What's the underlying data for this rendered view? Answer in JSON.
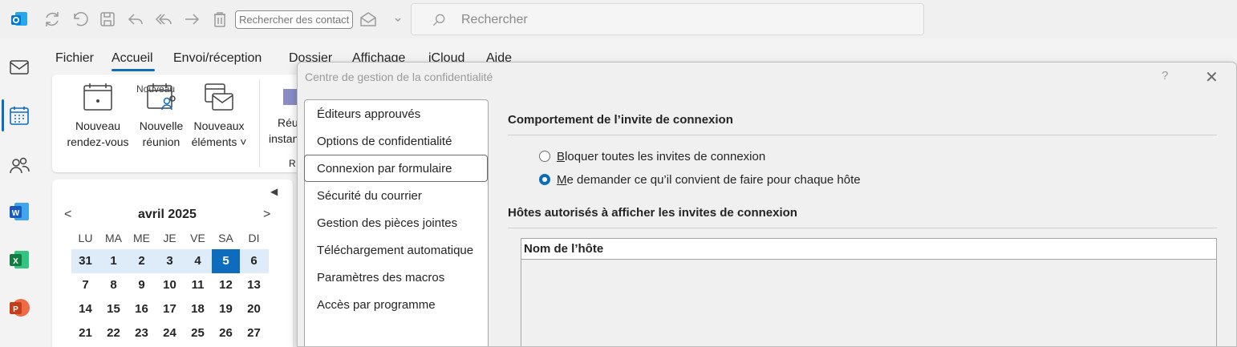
{
  "toolbar": {
    "contact_search_placeholder": "Rechercher des contacts",
    "search_placeholder": "Rechercher"
  },
  "rail": {
    "items": [
      "mail-icon",
      "calendar-icon",
      "people-icon",
      "word-icon",
      "excel-icon",
      "powerpoint-icon"
    ]
  },
  "menu": {
    "tabs": [
      "Fichier",
      "Accueil",
      "Envoi/réception",
      "Dossier",
      "Affichage",
      "iCloud",
      "Aide"
    ],
    "active": "Accueil"
  },
  "ribbon": {
    "new_appointment": [
      "Nouveau",
      "rendez-vous"
    ],
    "new_meeting": [
      "Nouvelle",
      "réunion"
    ],
    "new_items": [
      "Nouveaux",
      "éléments ˅"
    ],
    "cut_1": "Réu",
    "cut_2": "instan",
    "cut_3": "R",
    "group_label": "Nouveau"
  },
  "calendar": {
    "title": "avril 2025",
    "weekdays": [
      "LU",
      "MA",
      "ME",
      "JE",
      "VE",
      "SA",
      "DI"
    ],
    "weeks": [
      [
        "31",
        "1",
        "2",
        "3",
        "4",
        "5",
        "6"
      ],
      [
        "7",
        "8",
        "9",
        "10",
        "11",
        "12",
        "13"
      ],
      [
        "14",
        "15",
        "16",
        "17",
        "18",
        "19",
        "20"
      ],
      [
        "21",
        "22",
        "23",
        "24",
        "25",
        "26",
        "27"
      ]
    ],
    "today": "5"
  },
  "dialog": {
    "title": "Centre de gestion de la confidentialité",
    "help": "?",
    "close": "✕",
    "nav": [
      "Éditeurs approuvés",
      "Options de confidentialité",
      "Connexion par formulaire",
      "Sécurité du courrier",
      "Gestion des pièces jointes",
      "Téléchargement automatique",
      "Paramètres des macros",
      "Accès par programme"
    ],
    "nav_selected": "Connexion par formulaire",
    "section1_title": "Comportement de l’invite de connexion",
    "radio1": {
      "accel": "B",
      "rest": "loquer toutes les invites de connexion",
      "checked": false
    },
    "radio2": {
      "accel": "M",
      "rest": "e demander ce qu’il convient de faire pour chaque hôte",
      "checked": true
    },
    "section2_title": "Hôtes autorisés à afficher les invites de connexion",
    "hosts_column": "Nom de l’hôte"
  },
  "colors": {
    "accent": "#0f6cbd",
    "week_highlight": "#deecf9",
    "word": "#185abd",
    "excel": "#107c41",
    "powerpoint": "#c43e1c",
    "outlook": "#0078d4"
  }
}
